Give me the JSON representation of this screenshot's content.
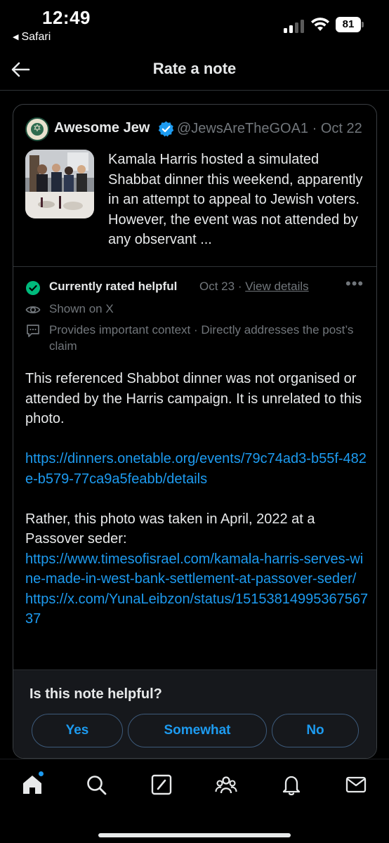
{
  "status_bar": {
    "time": "12:49",
    "back_app": "Safari",
    "battery": "81"
  },
  "header": {
    "title": "Rate a note"
  },
  "post": {
    "author_name": "Awesome Jew",
    "handle": "@JewsAreTheGOA1",
    "separator": "·",
    "date": "Oct 22",
    "text": "Kamala Harris hosted a simulated Shabbat dinner this weekend, apparently in an attempt to appeal to Jewish voters. However, the event was not attended by any observant ..."
  },
  "note": {
    "status": "Currently rated helpful",
    "date": "Oct 23",
    "separator": "·",
    "view_details": "View details",
    "shown_on": "Shown on X",
    "reasons": "Provides important context · Directly addresses the post’s claim",
    "body_line_1": "This referenced Shabbot dinner was not organised or attended by the Harris campaign. It is unrelated to this photo.",
    "link_1": "https://dinners.onetable.org/events/79c74ad3-b55f-482e-b579-77ca9a5feabb/details",
    "body_line_2": "Rather, this photo was taken in April, 2022 at a Passover seder:",
    "link_2": "https://www.timesofisrael.com/kamala-harris-serves-wine-made-in-west-bank-settlement-at-passover-seder/",
    "link_3": "https://x.com/YunaLeibzon/status/1515381499536756737"
  },
  "rating": {
    "question": "Is this note helpful?",
    "options": [
      "Yes",
      "Somewhat",
      "No"
    ]
  },
  "colors": {
    "accent": "#1d9bf0",
    "helpful_green": "#00ba7c",
    "muted": "#71767b"
  },
  "tabbar": {
    "items": [
      "home-icon",
      "search-icon",
      "grok-icon",
      "communities-icon",
      "notifications-icon",
      "messages-icon"
    ]
  }
}
